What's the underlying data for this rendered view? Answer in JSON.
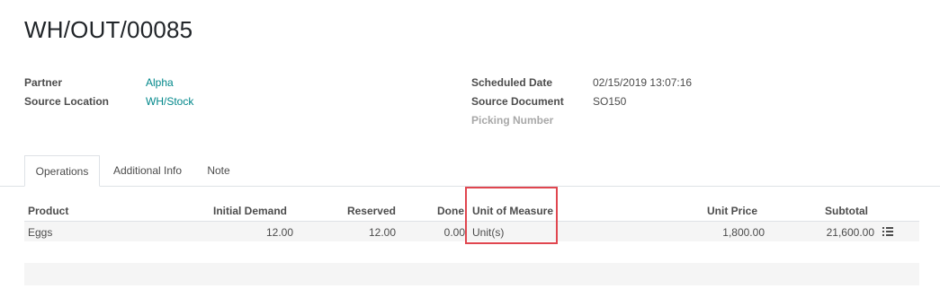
{
  "record": {
    "title": "WH/OUT/00085"
  },
  "fields_left": [
    {
      "label": "Partner",
      "value": "Alpha"
    },
    {
      "label": "Source Location",
      "value": "WH/Stock"
    }
  ],
  "fields_right": [
    {
      "label": "Scheduled Date",
      "value": "02/15/2019 13:07:16"
    },
    {
      "label": "Source Document",
      "value": "SO150"
    },
    {
      "label": "Picking Number",
      "value": ""
    }
  ],
  "tabs": [
    {
      "label": "Operations",
      "active": true
    },
    {
      "label": "Additional Info",
      "active": false
    },
    {
      "label": "Note",
      "active": false
    }
  ],
  "table": {
    "columns": [
      "Product",
      "Initial Demand",
      "Reserved",
      "Done",
      "Unit of Measure",
      "Unit Price",
      "Subtotal"
    ],
    "rows": [
      {
        "product": "Eggs",
        "initial_demand": "12.00",
        "reserved": "12.00",
        "done": "0.00",
        "uom": "Unit(s)",
        "unit_price": "1,800.00",
        "subtotal": "21,600.00",
        "detail_icon": "list-icon"
      }
    ]
  },
  "colors": {
    "link": "#00878a",
    "highlight": "#e0464f"
  }
}
